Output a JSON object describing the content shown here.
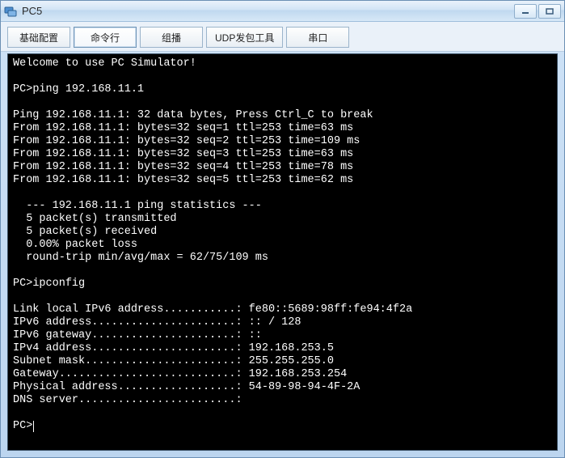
{
  "window": {
    "title": "PC5"
  },
  "tabs": {
    "basic": "基础配置",
    "cmd": "命令行",
    "multicast": "组播",
    "udptool": "UDP发包工具",
    "serial": "串口",
    "active": "cmd"
  },
  "terminal": {
    "welcome": "Welcome to use PC Simulator!",
    "prompt": "PC>",
    "cmd_ping": "ping 192.168.11.1",
    "ping_header": "Ping 192.168.11.1: 32 data bytes, Press Ctrl_C to break",
    "ping_replies": [
      "From 192.168.11.1: bytes=32 seq=1 ttl=253 time=63 ms",
      "From 192.168.11.1: bytes=32 seq=2 ttl=253 time=109 ms",
      "From 192.168.11.1: bytes=32 seq=3 ttl=253 time=63 ms",
      "From 192.168.11.1: bytes=32 seq=4 ttl=253 time=78 ms",
      "From 192.168.11.1: bytes=32 seq=5 ttl=253 time=62 ms"
    ],
    "stats_header": "--- 192.168.11.1 ping statistics ---",
    "stats_lines": [
      "5 packet(s) transmitted",
      "5 packet(s) received",
      "0.00% packet loss",
      "round-trip min/avg/max = 62/75/109 ms"
    ],
    "cmd_ipconfig": "ipconfig",
    "ipconfig_lines": [
      "Link local IPv6 address...........: fe80::5689:98ff:fe94:4f2a",
      "IPv6 address......................: :: / 128",
      "IPv6 gateway......................: ::",
      "IPv4 address......................: 192.168.253.5",
      "Subnet mask.......................: 255.255.255.0",
      "Gateway...........................: 192.168.253.254",
      "Physical address..................: 54-89-98-94-4F-2A",
      "DNS server........................:"
    ]
  }
}
